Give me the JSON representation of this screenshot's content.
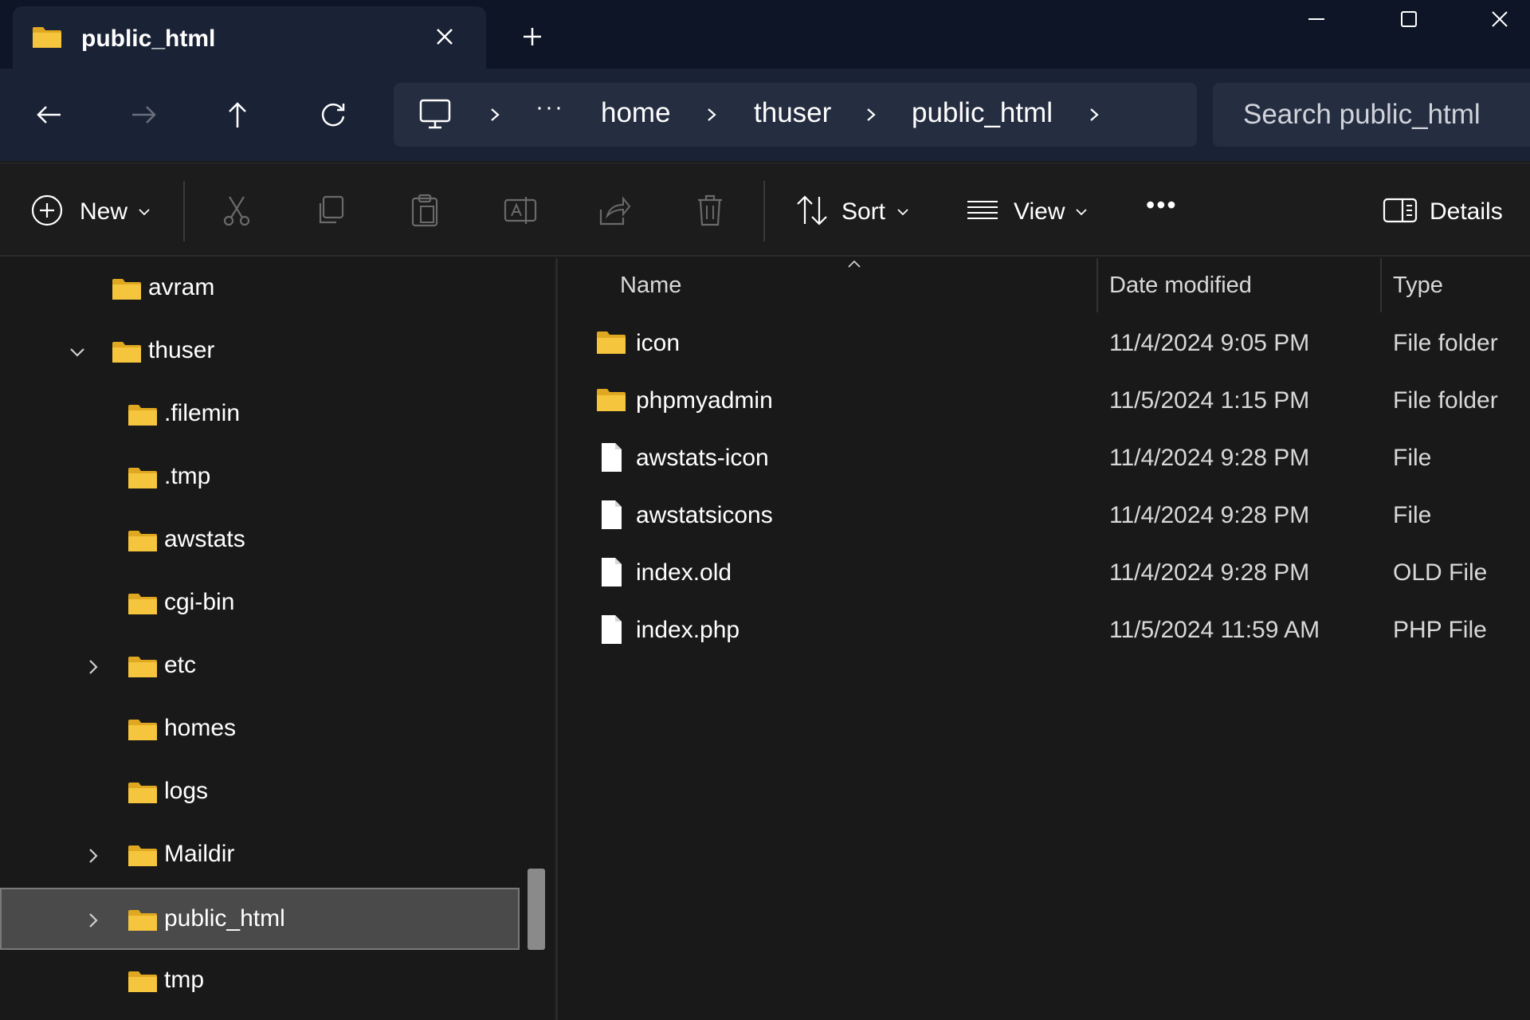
{
  "tab": {
    "title": "public_html"
  },
  "address": {
    "overflow": "···",
    "crumbs": [
      "home",
      "thuser",
      "public_html"
    ]
  },
  "search": {
    "placeholder": "Search public_html"
  },
  "toolbar": {
    "new_label": "New",
    "sort_label": "Sort",
    "view_label": "View",
    "more_label": "•••",
    "details_label": "Details"
  },
  "tree": [
    {
      "label": "avram"
    },
    {
      "label": "thuser"
    },
    {
      "label": ".filemin"
    },
    {
      "label": ".tmp"
    },
    {
      "label": "awstats"
    },
    {
      "label": "cgi-bin"
    },
    {
      "label": "etc"
    },
    {
      "label": "homes"
    },
    {
      "label": "logs"
    },
    {
      "label": "Maildir"
    },
    {
      "label": "public_html"
    },
    {
      "label": "tmp"
    }
  ],
  "columns": {
    "name": "Name",
    "date": "Date modified",
    "type": "Type"
  },
  "files": [
    {
      "name": "icon",
      "date": "11/4/2024 9:05 PM",
      "type": "File folder",
      "icon": "folder-icon"
    },
    {
      "name": "phpmyadmin",
      "date": "11/5/2024 1:15 PM",
      "type": "File folder",
      "icon": "folder-icon"
    },
    {
      "name": "awstats-icon",
      "date": "11/4/2024 9:28 PM",
      "type": "File",
      "icon": "file-icon"
    },
    {
      "name": "awstatsicons",
      "date": "11/4/2024 9:28 PM",
      "type": "File",
      "icon": "file-icon"
    },
    {
      "name": "index.old",
      "date": "11/4/2024 9:28 PM",
      "type": "OLD File",
      "icon": "file-icon"
    },
    {
      "name": "index.php",
      "date": "11/5/2024 11:59 AM",
      "type": "PHP File",
      "icon": "file-icon"
    }
  ],
  "colors": {
    "folder": "#f5c53d",
    "folder_dark": "#e0a820",
    "title_bg": "#0d1526",
    "nav_bg": "#1a2236",
    "selected": "#4a4a4a"
  }
}
